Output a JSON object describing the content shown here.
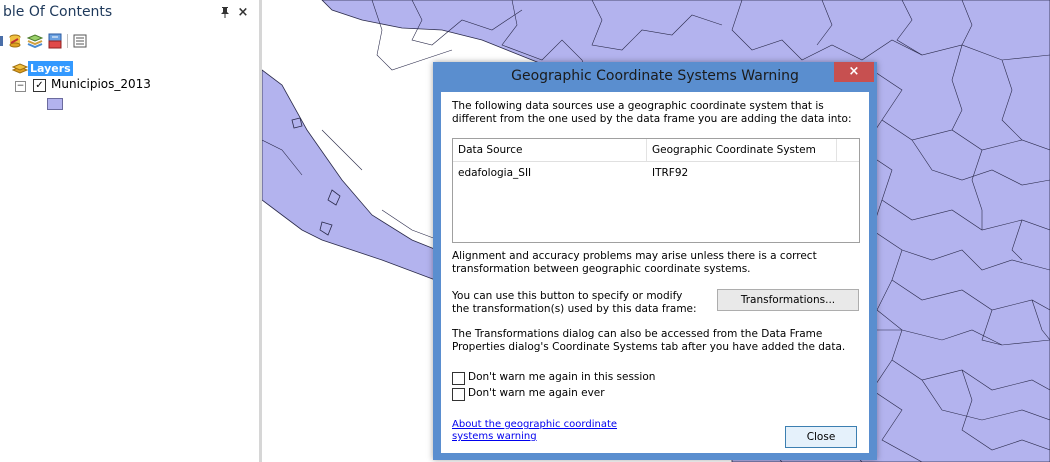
{
  "toc": {
    "title": "ble Of Contents",
    "pin_icon": "p",
    "close_icon": "×",
    "root_layer": "Layers",
    "layer": {
      "name": "Municipios_2013",
      "checked": true,
      "expander": "−",
      "check_mark": "✓",
      "swatch_color": "#b3b3ee"
    }
  },
  "dialog": {
    "title": "Geographic Coordinate Systems Warning",
    "close_glyph": "×",
    "intro": "The following data sources use a geographic coordinate system that is different from the one used by the data frame you are adding the data into:",
    "table": {
      "columns": [
        "Data Source",
        "Geographic Coordinate System"
      ],
      "rows": [
        [
          "edafologia_SII",
          "ITRF92"
        ]
      ]
    },
    "alignment_note": "Alignment and accuracy problems may arise unless there is a correct transformation between geographic coordinate systems.",
    "use_button_text": "You can use this button to specify or modify the transformation(s) used by this data frame:",
    "transformations_button": "Transformations...",
    "properties_note": "The Transformations dialog can also be accessed from the Data Frame Properties dialog's Coordinate Systems tab after you have added the data.",
    "checkbox_session": "Don't warn me again in this session",
    "checkbox_ever": "Don't warn me again ever",
    "about_link": "About the geographic coordinate systems warning",
    "close_button": "Close"
  },
  "colors": {
    "map_fill": "#b3b3ee",
    "map_stroke": "#2a2a4a",
    "dialog_frame": "#5a8ecf",
    "close_red": "#c75050",
    "selection": "#3399ff"
  }
}
